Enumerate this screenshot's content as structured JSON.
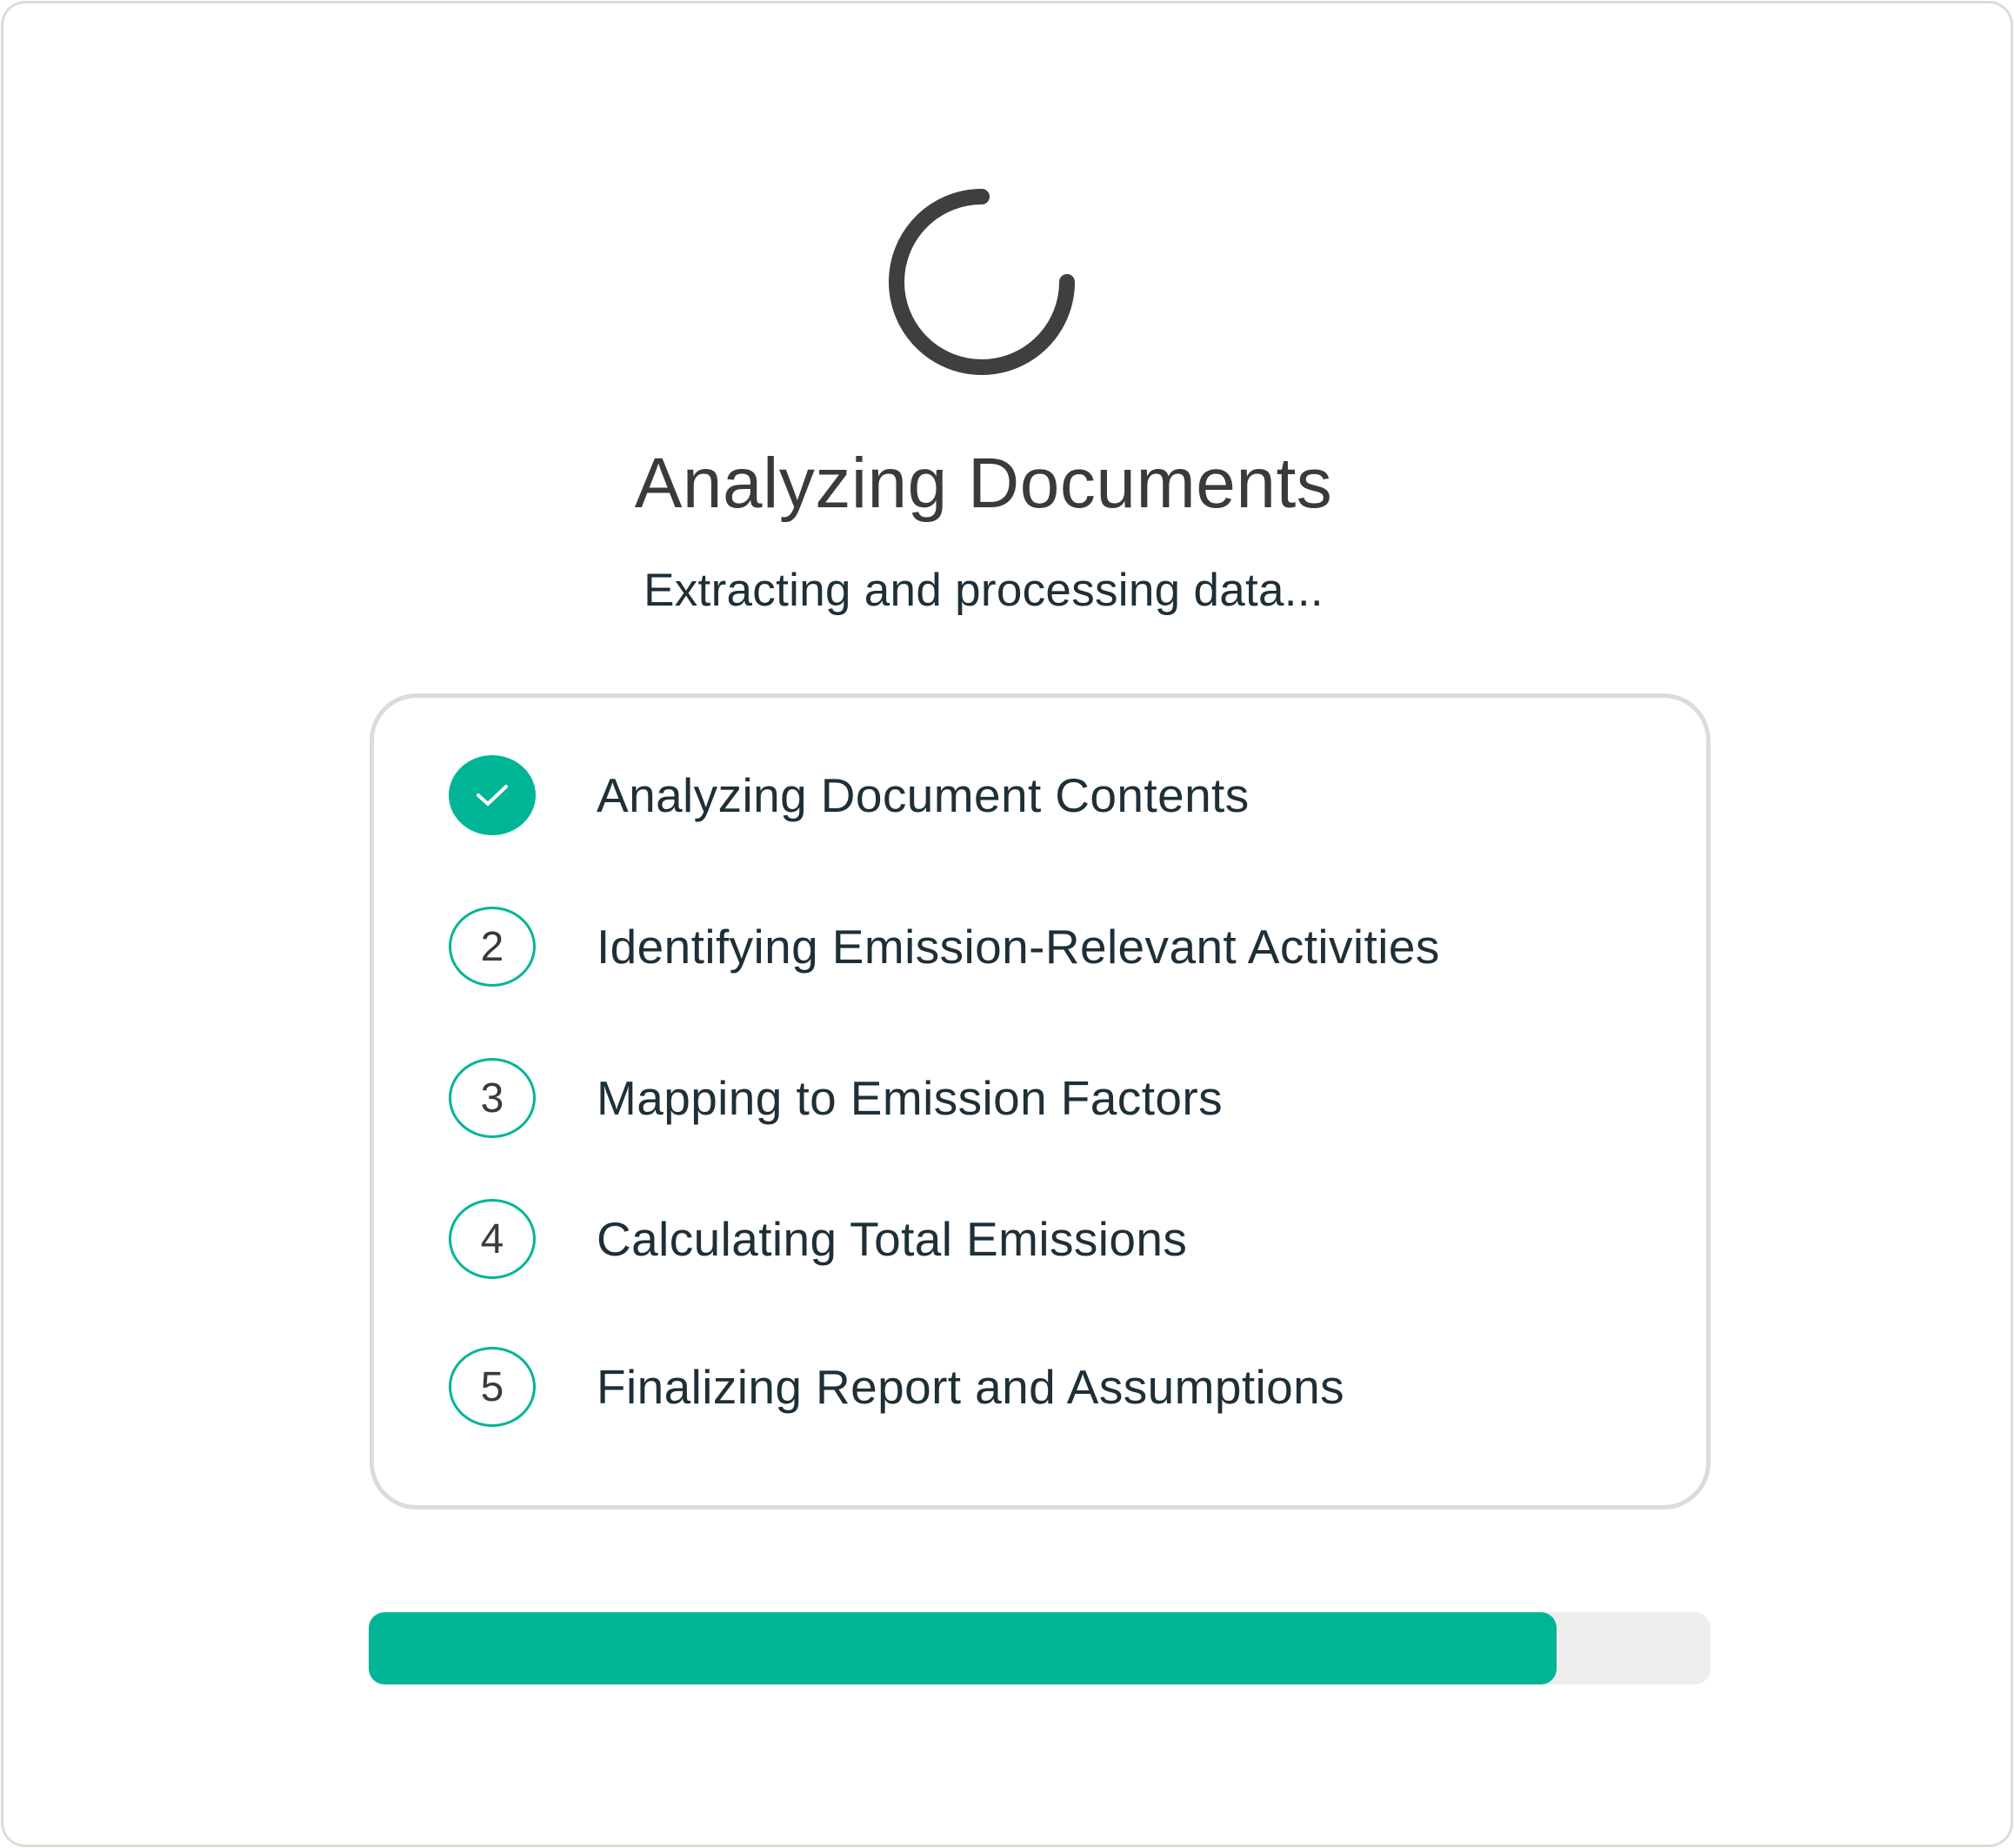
{
  "loader": {
    "title": "Analyzing Documents",
    "subtitle": "Extracting and processing data..."
  },
  "steps": [
    {
      "marker": "",
      "label": "Analyzing Document Contents",
      "status": "completed",
      "icon": "check-icon"
    },
    {
      "marker": "2",
      "label": "Identifying Emission-Relevant Activities",
      "status": "pending"
    },
    {
      "marker": "3",
      "label": "Mapping to Emission Factors",
      "status": "pending"
    },
    {
      "marker": "4",
      "label": "Calculating Total Emissions",
      "status": "pending"
    },
    {
      "marker": "5",
      "label": "Finalizing Report and Assumptions",
      "status": "pending"
    }
  ],
  "progress": {
    "fraction": 0.885
  },
  "colors": {
    "accent": "#00b596",
    "track": "#eeeeee",
    "border": "#dcdcd6",
    "text_dark": "#1e2f38",
    "text_heading": "#3a3a3a",
    "spinner": "#3f3f3f"
  },
  "icons": {
    "spinner": "loading-spinner-icon",
    "completed": "check-icon"
  }
}
